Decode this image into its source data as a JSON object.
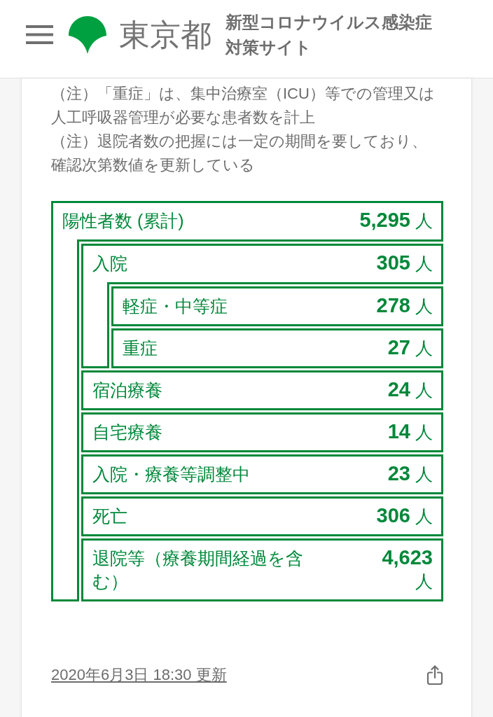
{
  "header": {
    "site_name": "東京都",
    "site_title": "新型コロナウイルス感染症対策サイト"
  },
  "notes": [
    "（注）「重症」は、集中治療室（ICU）等での管理又は人工呼吸器管理が必要な患者数を計上",
    "（注）退院者数の把握には一定の期間を要しており、確認次第数値を更新している"
  ],
  "breakdown": {
    "label": "陽性者数 (累計)",
    "value": "5,295",
    "unit": "人",
    "children": [
      {
        "label": "入院",
        "value": "305",
        "unit": "人",
        "children": [
          {
            "label": "軽症・中等症",
            "value": "278",
            "unit": "人"
          },
          {
            "label": "重症",
            "value": "27",
            "unit": "人"
          }
        ]
      },
      {
        "label": "宿泊療養",
        "value": "24",
        "unit": "人"
      },
      {
        "label": "自宅療養",
        "value": "14",
        "unit": "人"
      },
      {
        "label": "入院・療養等調整中",
        "value": "23",
        "unit": "人"
      },
      {
        "label": "死亡",
        "value": "306",
        "unit": "人"
      },
      {
        "label": "退院等（療養期間経過を含む）",
        "value": "4,623",
        "unit": "人"
      }
    ]
  },
  "last_updated": "2020年6月3日 18:30 更新"
}
